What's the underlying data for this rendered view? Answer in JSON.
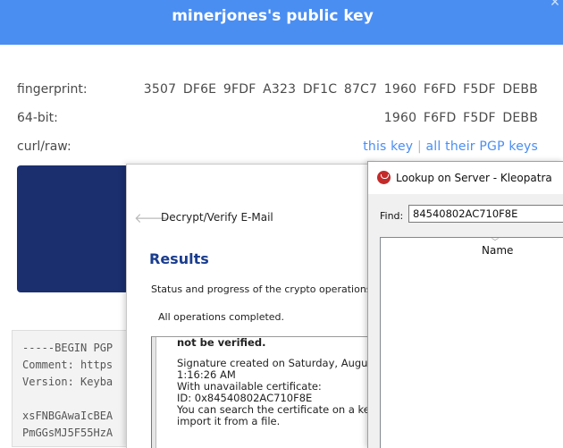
{
  "keybase": {
    "title": "minerjones's public key",
    "close_icon": "×",
    "fingerprint_label": "fingerprint:",
    "fingerprint_value": "3507 DF6E 9FDF A323 DF1C 87C7 1960 F6FD F5DF DEBB",
    "bit64_label": "64-bit:",
    "bit64_value": "1960 F6FD F5DF DEBB",
    "curl_label": "curl/raw:",
    "this_key_link": "this key",
    "separator": "|",
    "all_keys_link": "all their PGP keys",
    "pgp_block_text": "-----BEGIN PGP\nComment: https\nVersion: Keyba\n\nxsFNBGAwaIcBEA\nPmGGsMJ5F55HzA"
  },
  "decrypt_window": {
    "back_icon": "🡐",
    "title": "Decrypt/Verify E-Mail",
    "results_heading": "Results",
    "status_text": "Status and progress of the crypto operations",
    "complete_text": "All operations completed.",
    "result_bold": "not be verified.",
    "result_line1": "Signature created on Saturday, August",
    "result_line2": "1:16:26 AM",
    "result_line3": "With unavailable certificate:",
    "result_line4": "ID: 0x84540802AC710F8E",
    "result_line5": "You can search the certificate on a key",
    "result_line6": "import it from a file."
  },
  "kleopatra_window": {
    "title": "Lookup on Server - Kleopatra",
    "find_label": "Find:",
    "find_value": "84540802AC710F8E",
    "column_name": "Name",
    "sort_icon": "﹀",
    "accent_color": "#c32b2b"
  }
}
